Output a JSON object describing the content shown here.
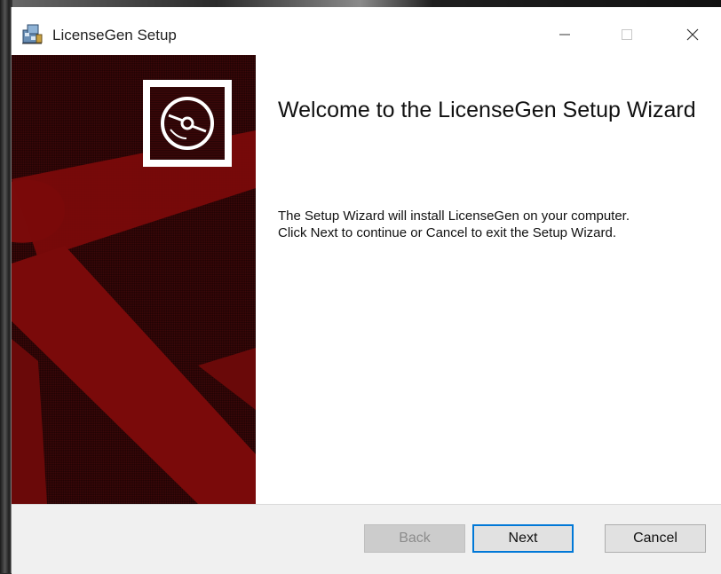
{
  "window": {
    "title": "LicenseGen Setup",
    "minimize_icon": "minimize-icon",
    "maximize_icon": "maximize-icon",
    "close_icon": "close-icon"
  },
  "welcome": {
    "title": "Welcome to the LicenseGen Setup Wizard",
    "line1": "The Setup Wizard will install LicenseGen on your computer.",
    "line2": "Click Next to continue or Cancel to exit the Setup Wizard."
  },
  "buttons": {
    "back": "Back",
    "next": "Next",
    "cancel": "Cancel"
  },
  "colors": {
    "banner_dark": "#3b0708",
    "banner_red": "#7a0a0a",
    "accent_focus": "#0078d7"
  }
}
